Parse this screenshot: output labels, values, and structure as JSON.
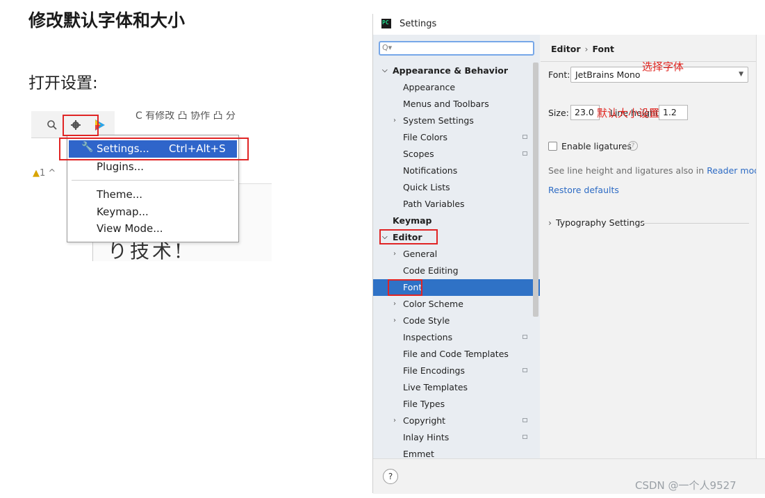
{
  "article": {
    "heading": "修改默认字体和大小",
    "subheading": "打开设置:"
  },
  "crop": {
    "toolbar_text": "C 有修改  凸 协作  凸 分",
    "warning_count": "1",
    "handwriting": "り技术!",
    "menu": {
      "items": [
        {
          "label": "Settings...",
          "shortcut": "Ctrl+Alt+S"
        },
        {
          "label": "Plugins..."
        },
        {
          "label": "Theme..."
        },
        {
          "label": "Keymap..."
        },
        {
          "label": "View Mode..."
        }
      ]
    }
  },
  "window": {
    "title": "Settings",
    "logo_text": "PC",
    "search_placeholder": "",
    "tree": [
      {
        "label": "Appearance & Behavior",
        "bold": true,
        "arrow": "expanded"
      },
      {
        "label": "Appearance"
      },
      {
        "label": "Menus and Toolbars"
      },
      {
        "label": "System Settings",
        "arrow": "collapsed"
      },
      {
        "label": "File Colors",
        "project": true
      },
      {
        "label": "Scopes",
        "project": true
      },
      {
        "label": "Notifications"
      },
      {
        "label": "Quick Lists"
      },
      {
        "label": "Path Variables"
      },
      {
        "label": "Keymap",
        "bold": true
      },
      {
        "label": "Editor",
        "bold": true,
        "arrow": "expanded"
      },
      {
        "label": "General",
        "arrow": "collapsed"
      },
      {
        "label": "Code Editing"
      },
      {
        "label": "Font",
        "selected": true
      },
      {
        "label": "Color Scheme",
        "arrow": "collapsed"
      },
      {
        "label": "Code Style",
        "arrow": "collapsed"
      },
      {
        "label": "Inspections",
        "project": true
      },
      {
        "label": "File and Code Templates"
      },
      {
        "label": "File Encodings",
        "project": true
      },
      {
        "label": "Live Templates"
      },
      {
        "label": "File Types"
      },
      {
        "label": "Copyright",
        "arrow": "collapsed",
        "project": true
      },
      {
        "label": "Inlay Hints",
        "project": true
      },
      {
        "label": "Emmet"
      }
    ],
    "content": {
      "breadcrumb": [
        "Editor",
        "Font"
      ],
      "font_label": "Font:",
      "font_value": "JetBrains Mono",
      "size_label": "Size:",
      "size_value": "23.0",
      "line_height_label": "Line height:",
      "line_height_value": "1.2",
      "ligatures_label": "Enable ligatures",
      "ligatures_checked": false,
      "hint_text": "See line height and ligatures also in",
      "hint_link": "Reader mode",
      "restore_defaults": "Restore defaults",
      "typography": "Typography Settings"
    },
    "annotations": {
      "choose_font": "选择字体",
      "default_size": "默认大小设置"
    },
    "help_button": "?"
  },
  "watermark": "CSDN @一个人9527",
  "colors": {
    "selection": "#2f72c6",
    "menu_selection": "#2f65ca",
    "link": "#2d6bc4",
    "annotation_red": "#e0241f",
    "sidebar_bg": "#e9edf2"
  }
}
